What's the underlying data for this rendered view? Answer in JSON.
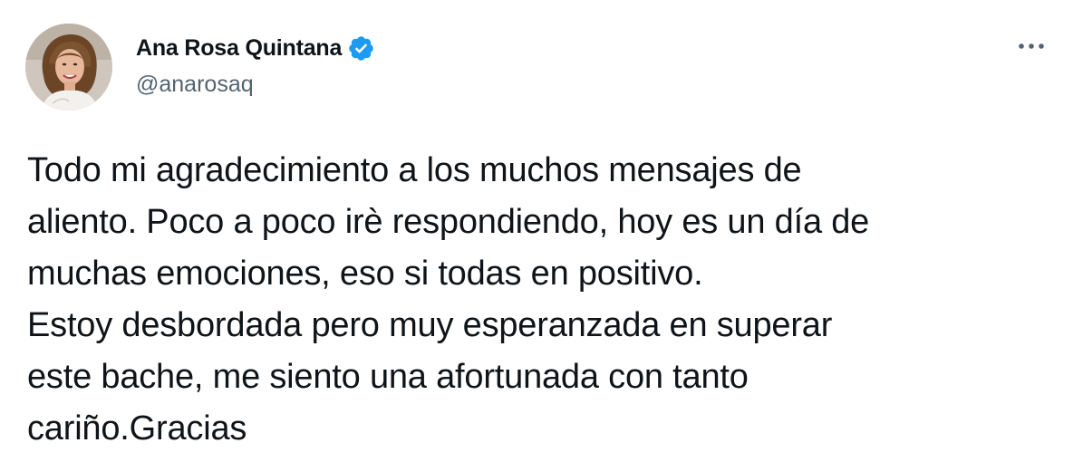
{
  "author": {
    "display_name": "Ana Rosa Quintana",
    "handle": "@anarosaq",
    "verified": true,
    "avatar_icon": "profile-photo"
  },
  "menu": {
    "icon": "more-options-icon"
  },
  "tweet": {
    "lines": [
      "Todo mi agradecimiento a los muchos mensajes de",
      "aliento. Poco a poco irè respondiendo, hoy es un día de",
      "muchas emociones, eso si todas en positivo.",
      "Estoy desbordada pero muy esperanzada en superar",
      "este bache, me siento una afortunada con tanto",
      "cariño.Gracias"
    ]
  },
  "colors": {
    "text_primary": "#0f1419",
    "text_secondary": "#536471",
    "verified_blue": "#1d9bf0",
    "background": "#ffffff"
  }
}
